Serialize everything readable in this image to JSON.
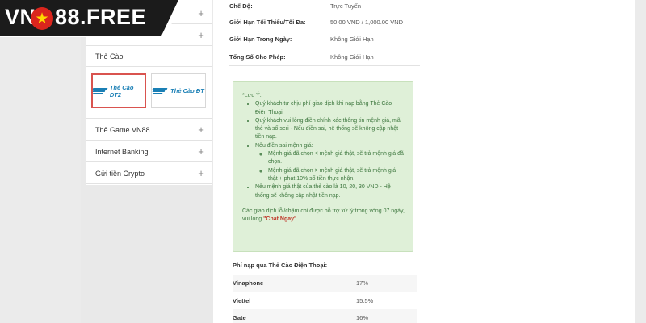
{
  "brand": {
    "name_left": "VN",
    "name_right": "88.FREE",
    "star": "★"
  },
  "sidebar": {
    "items": [
      {
        "label": "",
        "sign": "+"
      },
      {
        "label": "",
        "sign": "+"
      },
      {
        "label": "Thẻ Cào",
        "sign": "–"
      },
      {
        "label": "Thẻ Game VN88",
        "sign": "+"
      },
      {
        "label": "Internet Banking",
        "sign": "+"
      },
      {
        "label": "Gửi tiền Crypto",
        "sign": "+"
      }
    ],
    "cards": [
      {
        "label": "Thẻ Cào DT2",
        "selected": true
      },
      {
        "label": "Thẻ Cào ĐT",
        "selected": false
      }
    ]
  },
  "info": {
    "rows": [
      {
        "key": "Chế Độ:",
        "value": "Trực Tuyến"
      },
      {
        "key": "Giới Hạn Tối Thiểu/Tối Đa:",
        "value": "50.00 VND / 1,000.00 VND"
      },
      {
        "key": "Giới Hạn Trong Ngày:",
        "value": "Không Giới Hạn"
      },
      {
        "key": "Tổng Số Cho Phép:",
        "value": "Không Giới Hạn"
      }
    ]
  },
  "notice": {
    "heading": "*Lưu Ý:",
    "b1": "Quý khách tự chịu phí giao dịch khi nạp bằng Thẻ Cào Điện Thoại",
    "b2": "Quý khách vui lòng điền chính xác thông tin mệnh giá, mã thẻ và số seri - Nếu điền sai, hệ thống sẽ không cập nhật tiền nạp.",
    "b3": "Nếu điền sai mệnh giá:",
    "b3a": "Mệnh giá đã chọn < mệnh giá thật, sẽ trả mệnh giá đã chọn.",
    "b3b": "Mệnh giá đã chọn > mệnh giá thật, sẽ trả mệnh giá thật + phạt 10% số tiền thực nhận.",
    "b4": "Nếu mệnh giá thật của thẻ cào là 10, 20, 30 VND - Hệ thống sẽ không cập nhật tiền nạp.",
    "footer": "Các giao dịch lỗi/chậm chỉ được hỗ trợ xử lý trong vòng 07 ngày, vui lòng ",
    "chat": "\"Chat Ngay\""
  },
  "fees": {
    "title": "Phí nạp qua Thẻ Cào Điện Thoại:",
    "rows": [
      {
        "carrier": "Vinaphone",
        "fee": "17%"
      },
      {
        "carrier": "Viettel",
        "fee": "15.5%"
      },
      {
        "carrier": "Gate",
        "fee": "16%"
      }
    ]
  },
  "colors": {
    "accent_red": "#da251d",
    "notice_bg": "#dff0d8",
    "card_blue": "#1a7fb5"
  }
}
